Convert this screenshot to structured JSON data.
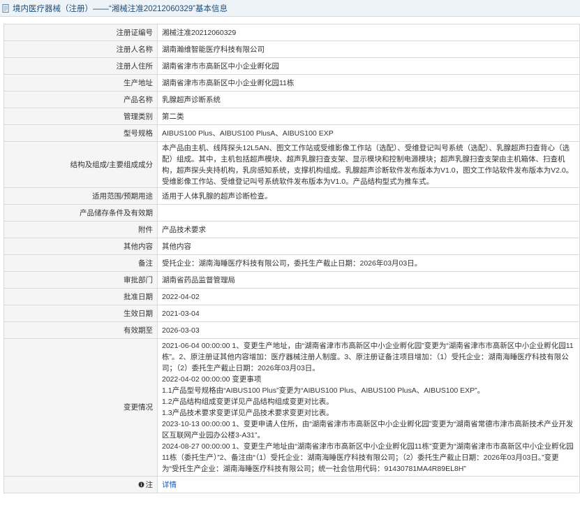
{
  "page": {
    "title": "境内医疗器械（注册）——“湘械注准20212060329”基本信息"
  },
  "colors": {
    "header_bg": "#eef3f8",
    "label_bg": "#f5f5f5",
    "border": "#d9d9d9",
    "link": "#1a5fb4",
    "title_text": "#1f4e79"
  },
  "rows": [
    {
      "label": "注册证编号",
      "value": "湘械注准20212060329"
    },
    {
      "label": "注册人名称",
      "value": "湖南瀚维智能医疗科技有限公司"
    },
    {
      "label": "注册人住所",
      "value": "湖南省津市市高新区中小企业孵化园"
    },
    {
      "label": "生产地址",
      "value": "湖南省津市市高新区中小企业孵化园11栋"
    },
    {
      "label": "产品名称",
      "value": "乳腺超声诊断系统"
    },
    {
      "label": "管理类别",
      "value": "第二类"
    },
    {
      "label": "型号规格",
      "value": "AIBUS100 Plus、AIBUS100 PlusA、AIBUS100 EXP"
    },
    {
      "label": "结构及组成/主要组成成分",
      "value": "本产品由主机、线阵探头12L5AN、图文工作站或受维影像工作站（选配）、受维登记叫号系统（选配）、乳腺超声扫查背心（选配）组成。其中，主机包括超声模块、超声乳腺扫查支架、显示模块和控制电源模块；超声乳腺扫查支架由主机箱体、扫查机构，超声探头夹持机构，乳房感知系统，支撑机构组成。乳腺超声诊断软件发布版本为V1.0，图文工作站软件发布版本为V2.0。受维影像工作站、受维登记叫号系统软件发布版本为V1.0。产品结构型式为推车式。"
    },
    {
      "label": "适用范围/预期用途",
      "value": "适用于人体乳腺的超声诊断检查。"
    },
    {
      "label": "产品储存条件及有效期",
      "value": ""
    },
    {
      "label": "附件",
      "value": "产品技术要求"
    },
    {
      "label": "其他内容",
      "value": "其他内容"
    },
    {
      "label": "备注",
      "value": "受托企业：湖南海睡医疗科技有限公司，委托生产截止日期：2026年03月03日。"
    },
    {
      "label": "审批部门",
      "value": "湖南省药品监督管理局"
    },
    {
      "label": "批准日期",
      "value": "2022-04-02"
    },
    {
      "label": "生效日期",
      "value": "2021-03-04"
    },
    {
      "label": "有效期至",
      "value": "2026-03-03"
    }
  ],
  "change": {
    "label": "变更情况",
    "lines": [
      "2021-06-04 00:00:00 1、变更生产地址，由“湖南省津市市高新区中小企业孵化园”变更为“湖南省津市市高新区中小企业孵化园11栋”。2、原注册证其他内容增加：医疗器械注册人制度。3、原注册证备注项目增加：（1）受托企业：湖南海睡医疗科技有限公司；（2）委托生产截止日期：2026年03月03日。",
      "2022-04-02 00:00:00 变更事项",
      "1.1产品型号规格由“AIBUS100 Plus”变更为“AIBUS100 Plus、AIBUS100 PlusA、AIBUS100 EXP”。",
      "1.2产品结构组成变更详见产品结构组成变更对比表。",
      "1.3产品技术要求变更详见产品技术要求变更对比表。",
      "2023-10-13 00:00:00 1、变更申请人住所，由“湖南省津市市高新区中小企业孵化园”变更为“湖南省常德市津市高新技术产业开发区互联网产业园办公楼3-A31”。",
      "2024-08-27 00:00:00 1、变更生产地址由“湖南省津市市高新区中小企业孵化园11栋”变更为“湖南省津市市高新区中小企业孵化园11栋（委托生产）”2、备注由“（1）受托企业：湖南海睡医疗科技有限公司；（2）委托生产截止日期：2026年03月03日。”变更为“受托生产企业：湖南海睡医疗科技有限公司；统一社会信用代码：91430781MA4R89EL8H”"
    ]
  },
  "footer": {
    "label": "注",
    "link": "详情",
    "icon": "info-circle-icon"
  }
}
